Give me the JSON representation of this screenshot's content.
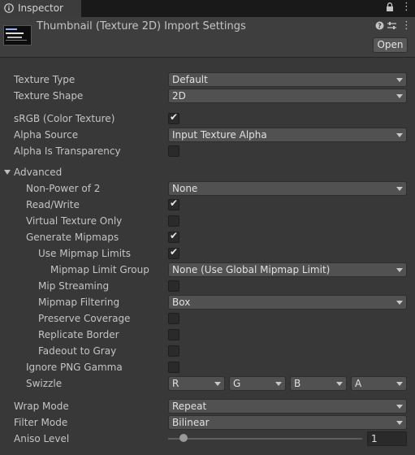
{
  "tab": {
    "label": "Inspector",
    "icon": "info-icon"
  },
  "header": {
    "title": "Thumbnail (Texture 2D) Import Settings",
    "open_label": "Open",
    "icons": [
      "help-icon",
      "preset-icon",
      "more-menu-icon"
    ]
  },
  "fields": {
    "texture_type": {
      "label": "Texture Type",
      "value": "Default"
    },
    "texture_shape": {
      "label": "Texture Shape",
      "value": "2D"
    },
    "srgb": {
      "label": "sRGB (Color Texture)",
      "checked": true
    },
    "alpha_source": {
      "label": "Alpha Source",
      "value": "Input Texture Alpha"
    },
    "alpha_is_transparency": {
      "label": "Alpha Is Transparency",
      "checked": false
    },
    "advanced": {
      "label": "Advanced",
      "expanded": true
    },
    "non_power_of_2": {
      "label": "Non-Power of 2",
      "value": "None"
    },
    "read_write": {
      "label": "Read/Write",
      "checked": true
    },
    "virtual_texture_only": {
      "label": "Virtual Texture Only",
      "checked": false
    },
    "generate_mipmaps": {
      "label": "Generate Mipmaps",
      "checked": true
    },
    "use_mipmap_limits": {
      "label": "Use Mipmap Limits",
      "checked": true
    },
    "mipmap_limit_group": {
      "label": "Mipmap Limit Group",
      "value": "None (Use Global Mipmap Limit)"
    },
    "mip_streaming": {
      "label": "Mip Streaming",
      "checked": false
    },
    "mipmap_filtering": {
      "label": "Mipmap Filtering",
      "value": "Box"
    },
    "preserve_coverage": {
      "label": "Preserve Coverage",
      "checked": false
    },
    "replicate_border": {
      "label": "Replicate Border",
      "checked": false
    },
    "fadeout_to_gray": {
      "label": "Fadeout to Gray",
      "checked": false
    },
    "ignore_png_gamma": {
      "label": "Ignore PNG Gamma",
      "checked": false
    },
    "swizzle": {
      "label": "Swizzle",
      "values": [
        "R",
        "G",
        "B",
        "A"
      ]
    },
    "wrap_mode": {
      "label": "Wrap Mode",
      "value": "Repeat"
    },
    "filter_mode": {
      "label": "Filter Mode",
      "value": "Bilinear"
    },
    "aniso_level": {
      "label": "Aniso Level",
      "value": "1",
      "fraction": 0.0625
    }
  }
}
